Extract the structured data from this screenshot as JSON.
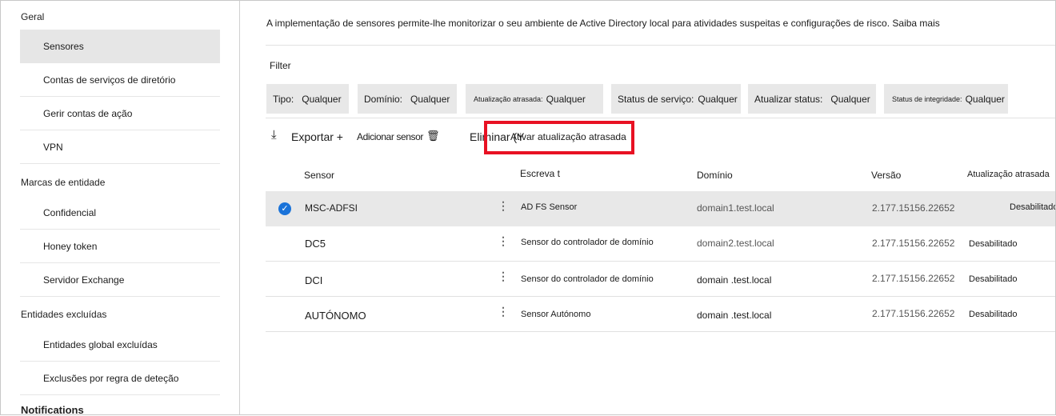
{
  "sidebar": {
    "geral": "Geral",
    "items_geral": [
      "Sensores",
      "Contas de serviços de diretório",
      "Gerir contas de ação",
      "VPN"
    ],
    "marcas": "Marcas de entidade",
    "items_marcas": [
      "Confidencial",
      "Honey token",
      "Servidor Exchange"
    ],
    "excluidas": "Entidades excluídas",
    "items_excl": [
      "Entidades global excluídas",
      "Exclusões por regra de deteção"
    ],
    "notifications": "Notifications"
  },
  "main": {
    "description": "A implementação de sensores permite-lhe monitorizar o seu ambiente de Active Directory local para atividades suspeitas e configurações de risco. Saiba mais",
    "filter_label": "Filter",
    "filters": [
      {
        "label": "Tipo:",
        "value": "Qualquer"
      },
      {
        "label": "Domínio:",
        "value": "Qualquer"
      },
      {
        "label": "Atualização atrasada:",
        "value": "Qualquer"
      },
      {
        "label": "Status de serviço:",
        "value": "Qualquer"
      },
      {
        "label": "Atualizar status:",
        "value": "Qualquer"
      },
      {
        "label": "Status de integridade:",
        "value": "Qualquer"
      }
    ],
    "toolbar": {
      "export": "Exportar +",
      "add": "Adicionar sensor",
      "delete": "Eliminar (Y",
      "delayed": "Ativar atualização atrasada"
    },
    "highlight_color": "#e81123",
    "columns": [
      "Sensor",
      "Escreva t",
      "Domínio",
      "Versão",
      "Atualização atrasada"
    ],
    "rows": [
      {
        "sensor": "MSC-ADFSI",
        "type": "AD FS Sensor",
        "domain": "domain1.test.local",
        "version": "2.177.15156.22652",
        "delayed": "Desabilitado",
        "selected": true
      },
      {
        "sensor": "DC5",
        "type": "Sensor do controlador de domínio",
        "domain": "domain2.test.local",
        "version": "2.177.15156.22652",
        "delayed": "Desabilitado",
        "selected": false
      },
      {
        "sensor": "DCI",
        "type": "Sensor do controlador de domínio",
        "domain": "domain .test.local",
        "version": "2.177.15156.22652",
        "delayed": "Desabilitado",
        "selected": false
      },
      {
        "sensor": "AUTÓNOMO",
        "type": "Sensor Autónomo",
        "domain": "domain .test.local",
        "version": "2.177.15156.22652",
        "delayed": "Desabilitado",
        "selected": false
      }
    ]
  }
}
